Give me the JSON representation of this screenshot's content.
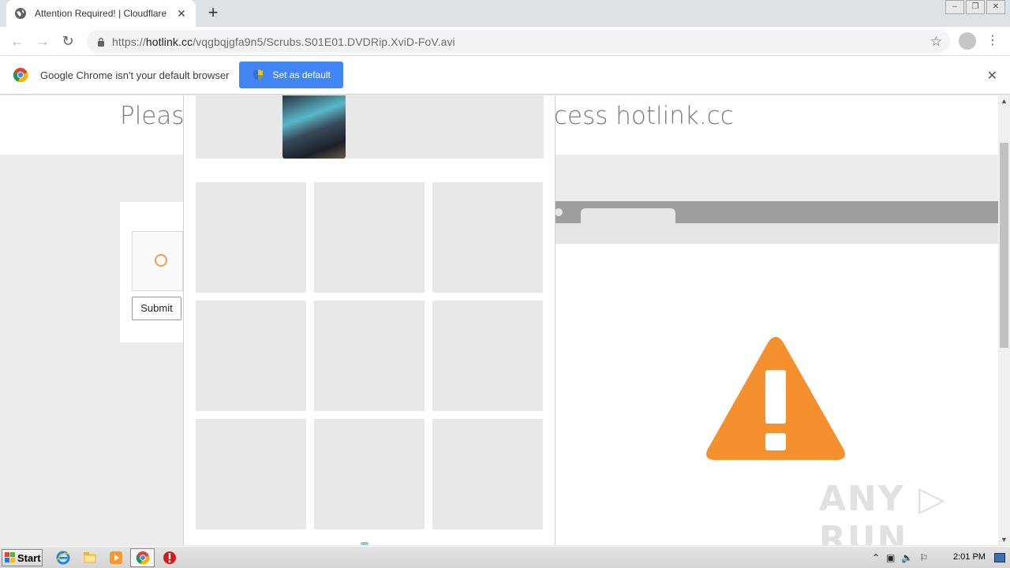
{
  "browser": {
    "tab_title": "Attention Required! | Cloudflare",
    "tab_close": "✕",
    "new_tab": "+",
    "window_controls": [
      "–",
      "❐",
      "✕"
    ],
    "url_prefix": "https://",
    "url_domain": "hotlink.cc",
    "url_path": "/vqgbqjgfa9n5/Scrubs.S01E01.DVDRip.XviD-FoV.avi",
    "back_icon": "←",
    "forward_icon": "→",
    "reload_icon": "↻",
    "star_icon": "☆",
    "menu_icon": "⋮"
  },
  "infobar": {
    "message": "Google Chrome isn't your default browser",
    "button_label": "Set as default",
    "close_icon": "✕"
  },
  "page": {
    "heading_left": "Please",
    "heading_right": "cess hotlink.cc",
    "submit_label": "Submit",
    "watermark": "ANY ▷ RUN"
  },
  "challenge": {
    "tiles": 9
  },
  "scrollbar": {
    "up": "▲",
    "down": "▼"
  },
  "taskbar": {
    "start_label": "Start",
    "tray_symbols": [
      "⌃",
      "▣",
      "🔈",
      "⚐"
    ],
    "clock": "2:01 PM"
  },
  "colors": {
    "accent_blue": "#4285f4",
    "warning_orange": "#f4902d",
    "spinner_orange": "#f39c4f"
  }
}
